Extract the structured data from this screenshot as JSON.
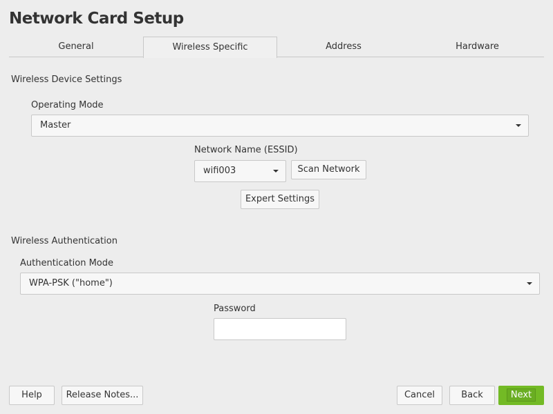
{
  "window": {
    "title": "Network Card Setup"
  },
  "tabs": [
    {
      "label": "General"
    },
    {
      "label": "Wireless Specific",
      "active": true
    },
    {
      "label": "Address"
    },
    {
      "label": "Hardware"
    }
  ],
  "device": {
    "section": "Wireless Device Settings",
    "operating_mode_label": "Operating Mode",
    "operating_mode_value": "Master",
    "essid_label": "Network Name (ESSID)",
    "essid_value": "wifi003",
    "scan_button": "Scan Network",
    "expert_button": "Expert Settings"
  },
  "auth": {
    "section": "Wireless Authentication",
    "mode_label": "Authentication Mode",
    "mode_value": "WPA-PSK (\"home\")",
    "password_label": "Password",
    "password_value": ""
  },
  "footer": {
    "help": "Help",
    "release_notes": "Release Notes...",
    "cancel": "Cancel",
    "back": "Back",
    "next": "Next"
  },
  "colors": {
    "accent": "#73ba25"
  }
}
